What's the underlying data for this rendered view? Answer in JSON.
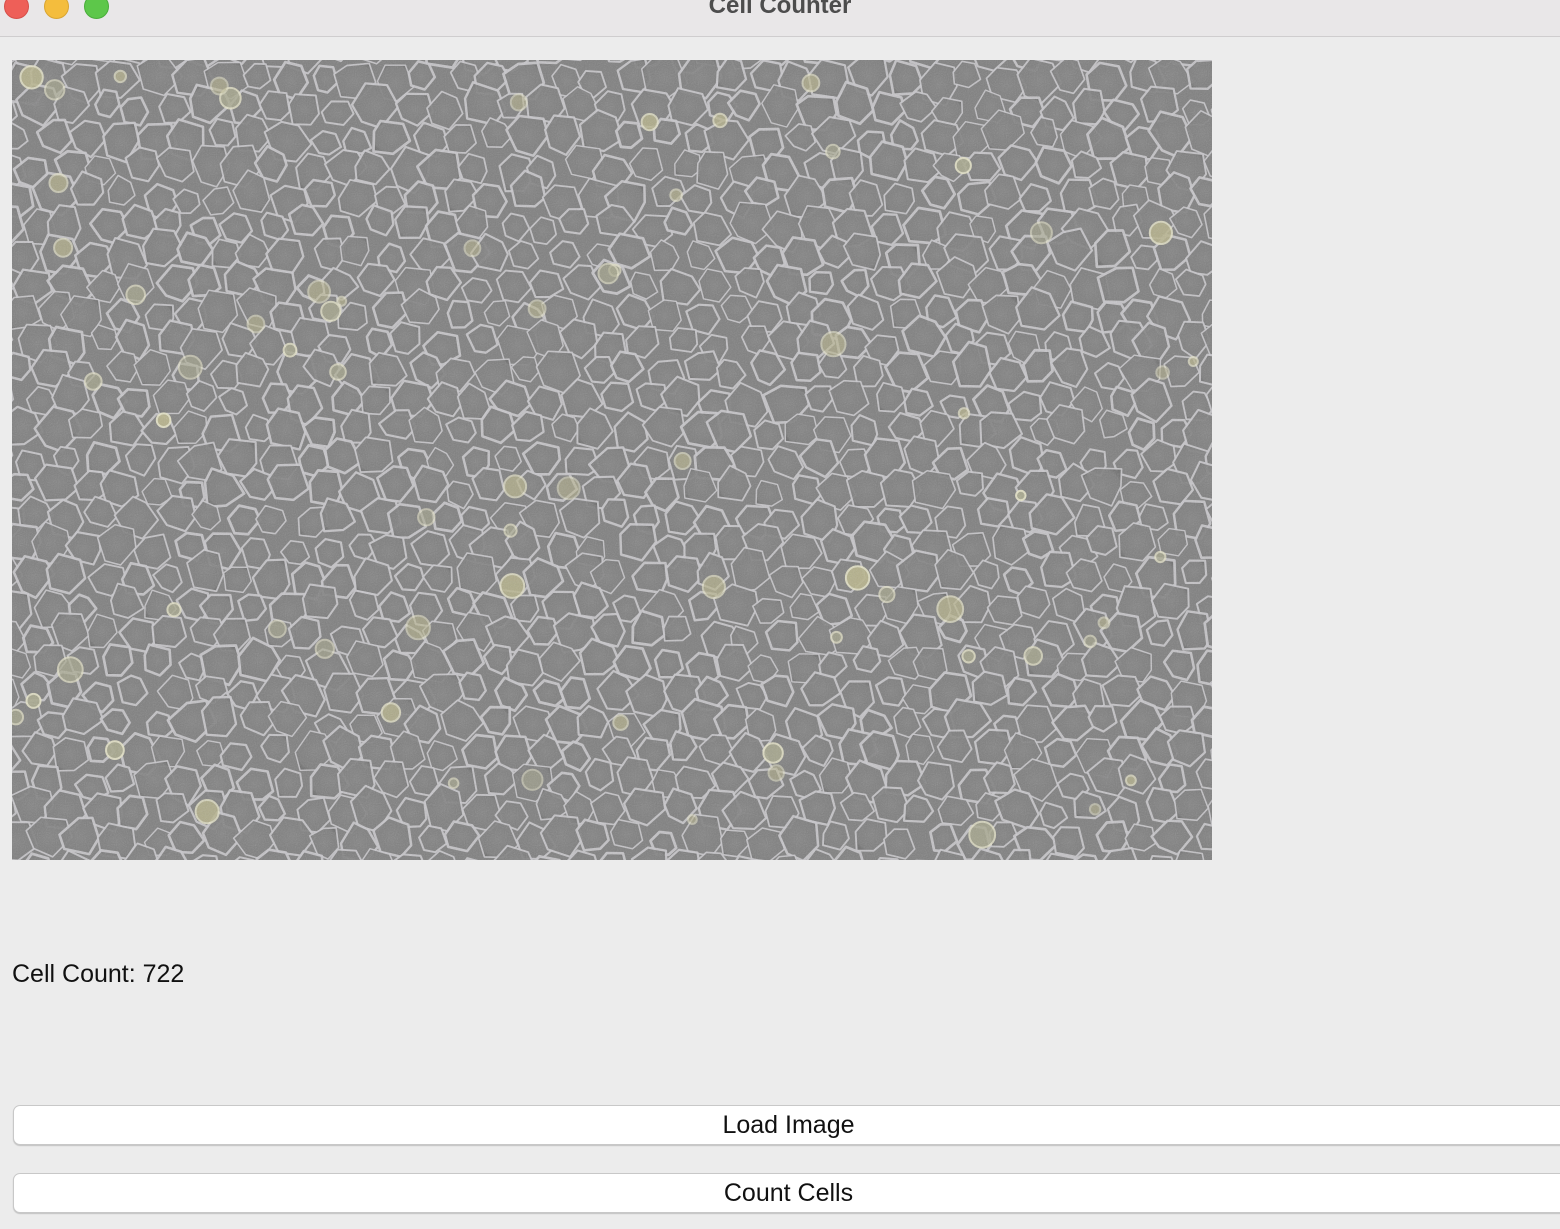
{
  "window": {
    "title": "Cell Counter"
  },
  "image": {
    "alt": "phase contrast micrograph of epithelial cell monolayer"
  },
  "result": {
    "label": "Cell Count: 722",
    "count": 722
  },
  "buttons": {
    "load_label": "Load Image",
    "count_label": "Count Cells"
  },
  "colors": {
    "window_bg": "#ececec",
    "close": "#ee5f58",
    "minimize": "#f4bd3d",
    "maximize": "#5dc74a"
  }
}
